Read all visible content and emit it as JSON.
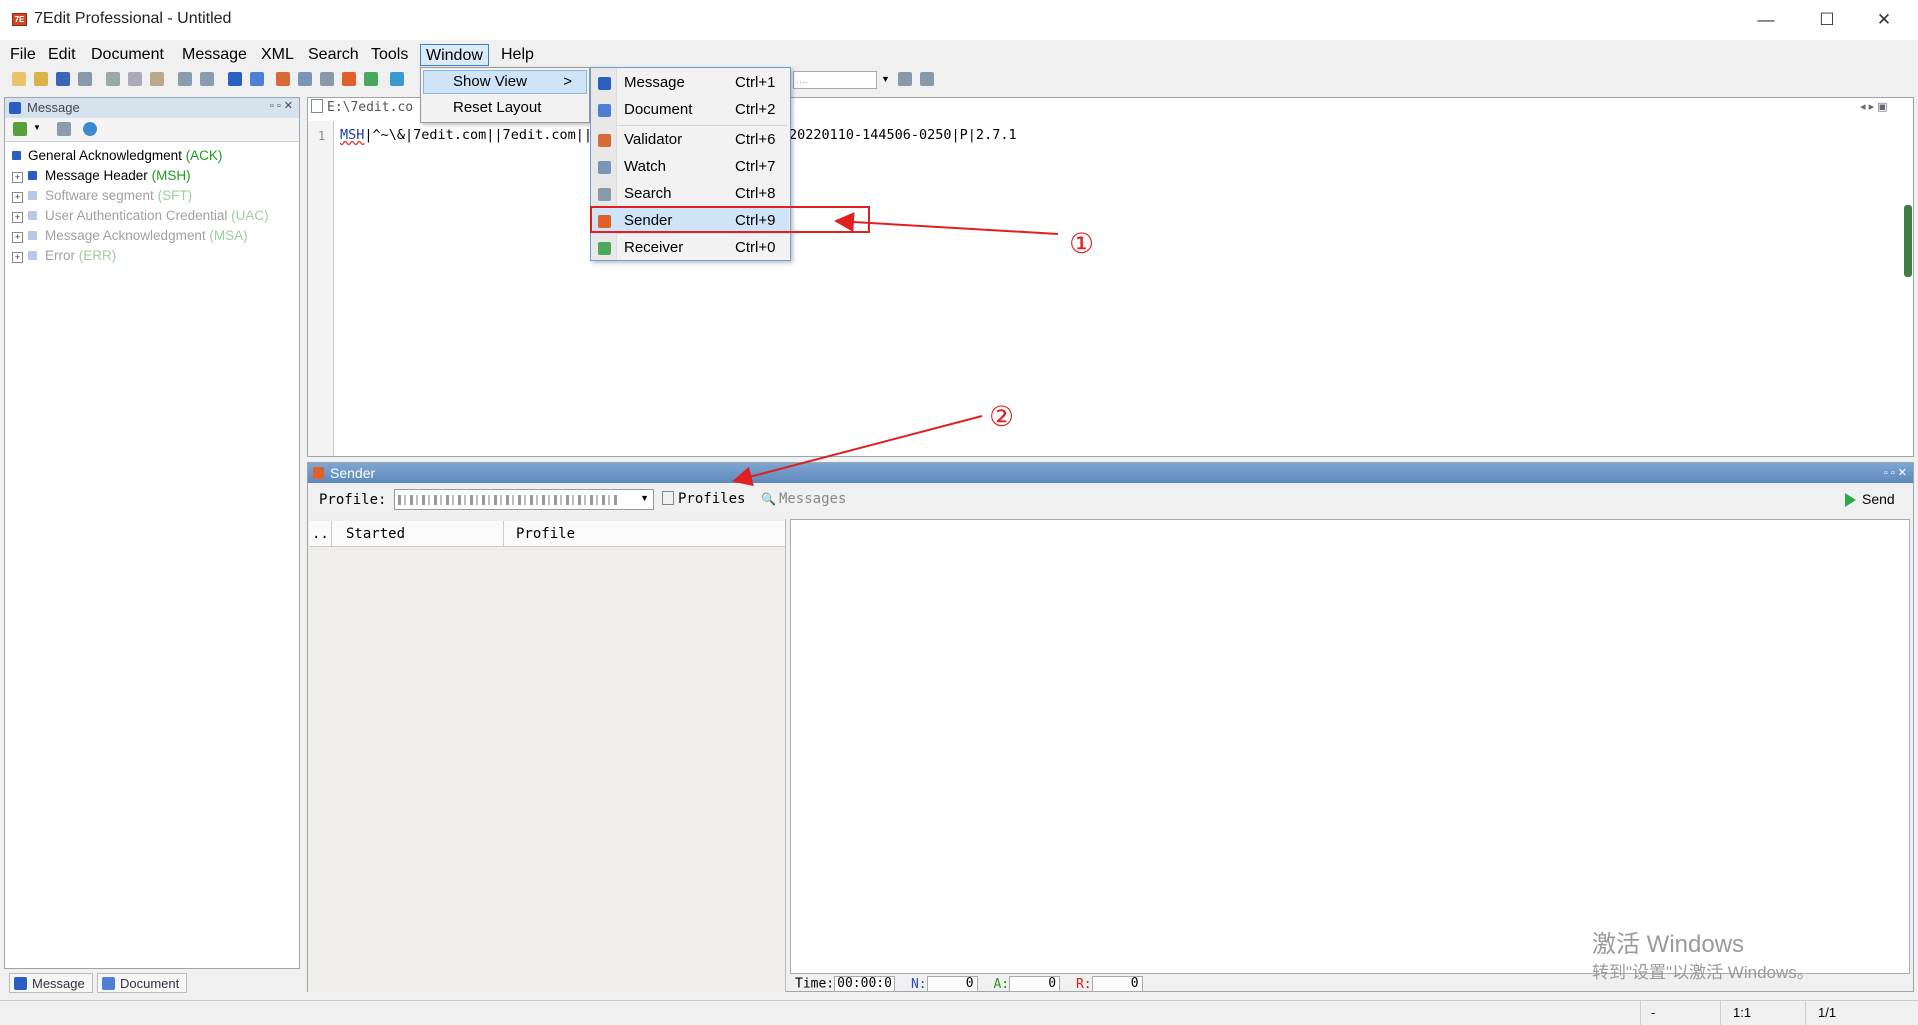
{
  "window": {
    "title": "7Edit Professional - Untitled",
    "controls": {
      "minimize": "—",
      "maximize": "☐",
      "close": "✕"
    }
  },
  "menubar": [
    "File",
    "Edit",
    "Document",
    "Message",
    "XML",
    "Search",
    "Tools",
    "Window",
    "Help"
  ],
  "window_menu": {
    "items": [
      {
        "label": "Show View",
        "arrow": ">"
      },
      {
        "label": "Reset Layout"
      }
    ]
  },
  "show_view_submenu": [
    {
      "label": "Message",
      "shortcut": "Ctrl+1",
      "icon": "message-icon"
    },
    {
      "label": "Document",
      "shortcut": "Ctrl+2",
      "icon": "document-icon"
    },
    {
      "label": "Validator",
      "shortcut": "Ctrl+6",
      "icon": "validator-icon"
    },
    {
      "label": "Watch",
      "shortcut": "Ctrl+7",
      "icon": "watch-icon"
    },
    {
      "label": "Search",
      "shortcut": "Ctrl+8",
      "icon": "search-icon"
    },
    {
      "label": "Sender",
      "shortcut": "Ctrl+9",
      "icon": "sender-icon",
      "highlighted": true
    },
    {
      "label": "Receiver",
      "shortcut": "Ctrl+0",
      "icon": "receiver-icon"
    }
  ],
  "message_panel": {
    "title": "Message",
    "root": {
      "label": "General Acknowledgment",
      "code": "(ACK)"
    },
    "segments": [
      {
        "label": "Message Header",
        "code": "(MSH)",
        "enabled": true
      },
      {
        "label": "Software segment",
        "code": "(SFT)",
        "enabled": false
      },
      {
        "label": "User Authentication Credential",
        "code": "(UAC)",
        "enabled": false
      },
      {
        "label": "Message Acknowledgment",
        "code": "(MSA)",
        "enabled": false
      },
      {
        "label": "Error",
        "code": "(ERR)",
        "enabled": false
      }
    ],
    "bottom_tabs": [
      "Message",
      "Document"
    ]
  },
  "editor": {
    "tab_label": "E:\\7edit.co",
    "line_number": "1",
    "segment": "MSH",
    "line_text": "|^~\\&|7edit.com||7edit.com||",
    "line_tail": "20220110-144506-0250|P|2.7.1"
  },
  "sender_panel": {
    "title": "Sender",
    "profile_label": "Profile:",
    "profiles_button": "Profiles",
    "messages_button": "Messages",
    "send_button": "Send",
    "columns": [
      "...",
      "Started",
      "Profile"
    ],
    "stats": {
      "time_label": "Time:",
      "time_value": "00:00:0",
      "n_label": "N:",
      "n_value": "0",
      "a_label": "A:",
      "a_value": "0",
      "r_label": "R:",
      "r_value": "0"
    }
  },
  "statusbar": {
    "field1": "-",
    "position": "1:1",
    "pages": "1/1"
  },
  "watermark": {
    "line1": "激活 Windows",
    "line2": "转到\"设置\"以激活 Windows。"
  },
  "annotations": {
    "marker1": "①",
    "marker2": "②"
  },
  "colors": {
    "annotation": "#e02020",
    "highlight": "#cfe4f7",
    "sender_header": "#6e97c6"
  }
}
